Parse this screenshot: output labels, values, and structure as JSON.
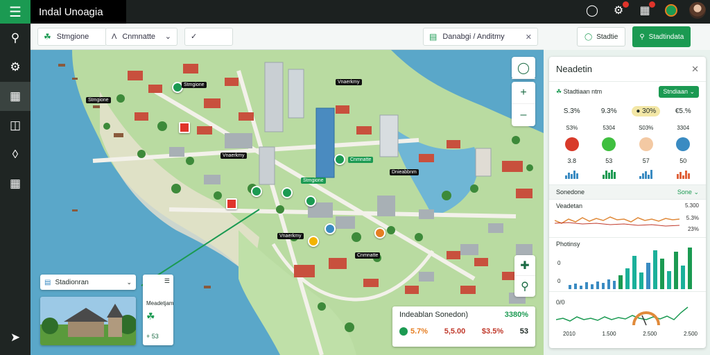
{
  "app": {
    "title": "Indal Unoagia"
  },
  "topbar": {
    "icons": [
      "circle-icon",
      "gauge-icon",
      "calendar-icon",
      "globe-icon"
    ]
  },
  "filters": {
    "first": {
      "label": "Stmgione"
    },
    "second": {
      "label": "Cnmnatte"
    },
    "right": {
      "label": "Danabgi / Anditmy"
    }
  },
  "rail": {
    "items": [
      "search-icon",
      "settings-icon",
      "calendar-icon",
      "layout-icon",
      "pin-icon",
      "chart-icon"
    ]
  },
  "map": {
    "location_select": "Stadionran",
    "mini_card": {
      "title": "Meadetjam",
      "value": "+ 53"
    },
    "bottom_card": {
      "title": "Indeablan Sonedon)",
      "change": "3380%",
      "values": [
        "5.7%",
        "5,5.00",
        "$3.5%",
        "53"
      ]
    },
    "labels": [
      "Stmgione",
      "Stmgione",
      "Vnaerkmy",
      "Vnaerkmy",
      "Cnmnatte",
      "Dnieabbnm",
      "Stmgione",
      "Vnaerkmy",
      "Cnmnatte"
    ]
  },
  "panel_actions": {
    "outline": "Stadtie",
    "primary": "Stadtindata"
  },
  "panel": {
    "title": "Neadetin",
    "subheader": {
      "label": "Stadtiaan ntm",
      "select": "Stndiaan"
    },
    "row1": [
      "S.3%",
      "9.3%",
      "30%",
      "€5.%"
    ],
    "row2": [
      "S3%",
      "5304",
      "S03%",
      "3304"
    ],
    "row3": [
      "3.8",
      "53",
      "57",
      "50"
    ],
    "circle_colors": [
      "#d83a2a",
      "#3fbf3f",
      "#f3c9a3",
      "#3a8bc2"
    ],
    "section": {
      "label": "Sonedone",
      "more": "Sone"
    },
    "chart1": {
      "title": "Veadetan",
      "value": "5.300",
      "side1": "5.3%",
      "side2": "23%"
    },
    "chart2": {
      "title": "Photinsy",
      "y_top": "0",
      "y_bottom": "0"
    },
    "chart3": {
      "title": "0/0",
      "x_ticks": [
        "2010",
        "1.500",
        "2.500",
        "2.500"
      ]
    }
  }
}
